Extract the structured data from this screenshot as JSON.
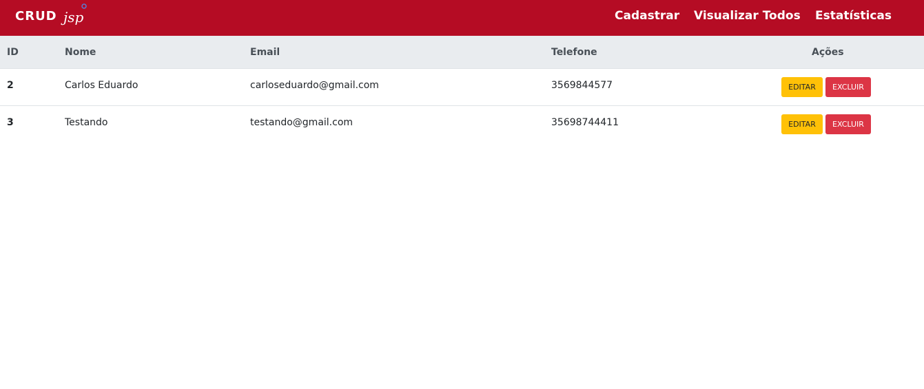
{
  "navbar": {
    "brand": {
      "crud": "CRUD",
      "jsp": "jsp"
    },
    "links": [
      {
        "label": "Cadastrar"
      },
      {
        "label": "Visualizar Todos"
      },
      {
        "label": "Estatísticas"
      }
    ]
  },
  "table": {
    "headers": {
      "id": "ID",
      "nome": "Nome",
      "email": "Email",
      "telefone": "Telefone",
      "acoes": "Ações"
    },
    "rows": [
      {
        "id": "2",
        "nome": "Carlos Eduardo",
        "email": "carloseduardo@gmail.com",
        "telefone": "3569844577",
        "edit_label": "EDITAR",
        "delete_label": "EXCLUIR"
      },
      {
        "id": "3",
        "nome": "Testando",
        "email": "testando@gmail.com",
        "telefone": "35698744411",
        "edit_label": "EDITAR",
        "delete_label": "EXCLUIR"
      }
    ]
  },
  "colors": {
    "navbar": "#b50c24",
    "header_bg": "#e9ecef",
    "edit_button": "#ffc107",
    "delete_button": "#dc3545"
  }
}
